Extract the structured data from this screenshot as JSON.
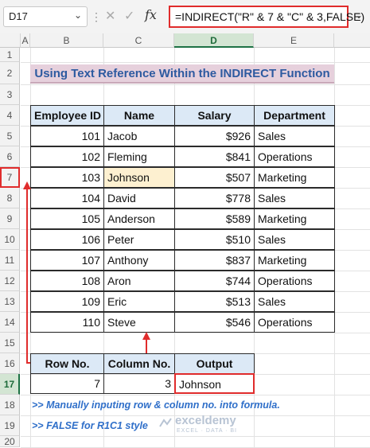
{
  "formula_bar": {
    "cell_ref": "D17",
    "fx": "fx",
    "formula": "=INDIRECT(\"R\" & 7 & \"C\" & 3,FALSE)"
  },
  "columns": [
    "A",
    "B",
    "C",
    "D",
    "E"
  ],
  "rows": [
    "1",
    "2",
    "3",
    "4",
    "5",
    "6",
    "7",
    "8",
    "9",
    "10",
    "11",
    "12",
    "13",
    "14",
    "15",
    "16",
    "17",
    "18",
    "19",
    "20"
  ],
  "title": "Using Text Reference Within the INDIRECT Function",
  "table": {
    "headers": [
      "Employee ID",
      "Name",
      "Salary",
      "Department"
    ],
    "rows": [
      [
        "101",
        "Jacob",
        "$926",
        "Sales"
      ],
      [
        "102",
        "Fleming",
        "$841",
        "Operations"
      ],
      [
        "103",
        "Johnson",
        "$507",
        "Marketing"
      ],
      [
        "104",
        "David",
        "$778",
        "Sales"
      ],
      [
        "105",
        "Anderson",
        "$589",
        "Marketing"
      ],
      [
        "106",
        "Peter",
        "$510",
        "Sales"
      ],
      [
        "107",
        "Anthony",
        "$837",
        "Marketing"
      ],
      [
        "108",
        "Aron",
        "$744",
        "Operations"
      ],
      [
        "109",
        "Eric",
        "$513",
        "Sales"
      ],
      [
        "110",
        "Steve",
        "$546",
        "Operations"
      ]
    ]
  },
  "lookup": {
    "headers": [
      "Row No.",
      "Column No.",
      "Output"
    ],
    "values": [
      "7",
      "3",
      "Johnson"
    ]
  },
  "notes": [
    ">> Manually inputing row & column no. into formula.",
    ">> FALSE for R1C1 style"
  ],
  "watermark": {
    "brand": "exceldemy",
    "tagline": "EXCEL · DATA · BI"
  },
  "colors": {
    "accent_red": "#e02c2c",
    "header_blue": "#dce9f6",
    "title_bg": "#e6d0dc",
    "note_blue": "#2f6fc9"
  }
}
